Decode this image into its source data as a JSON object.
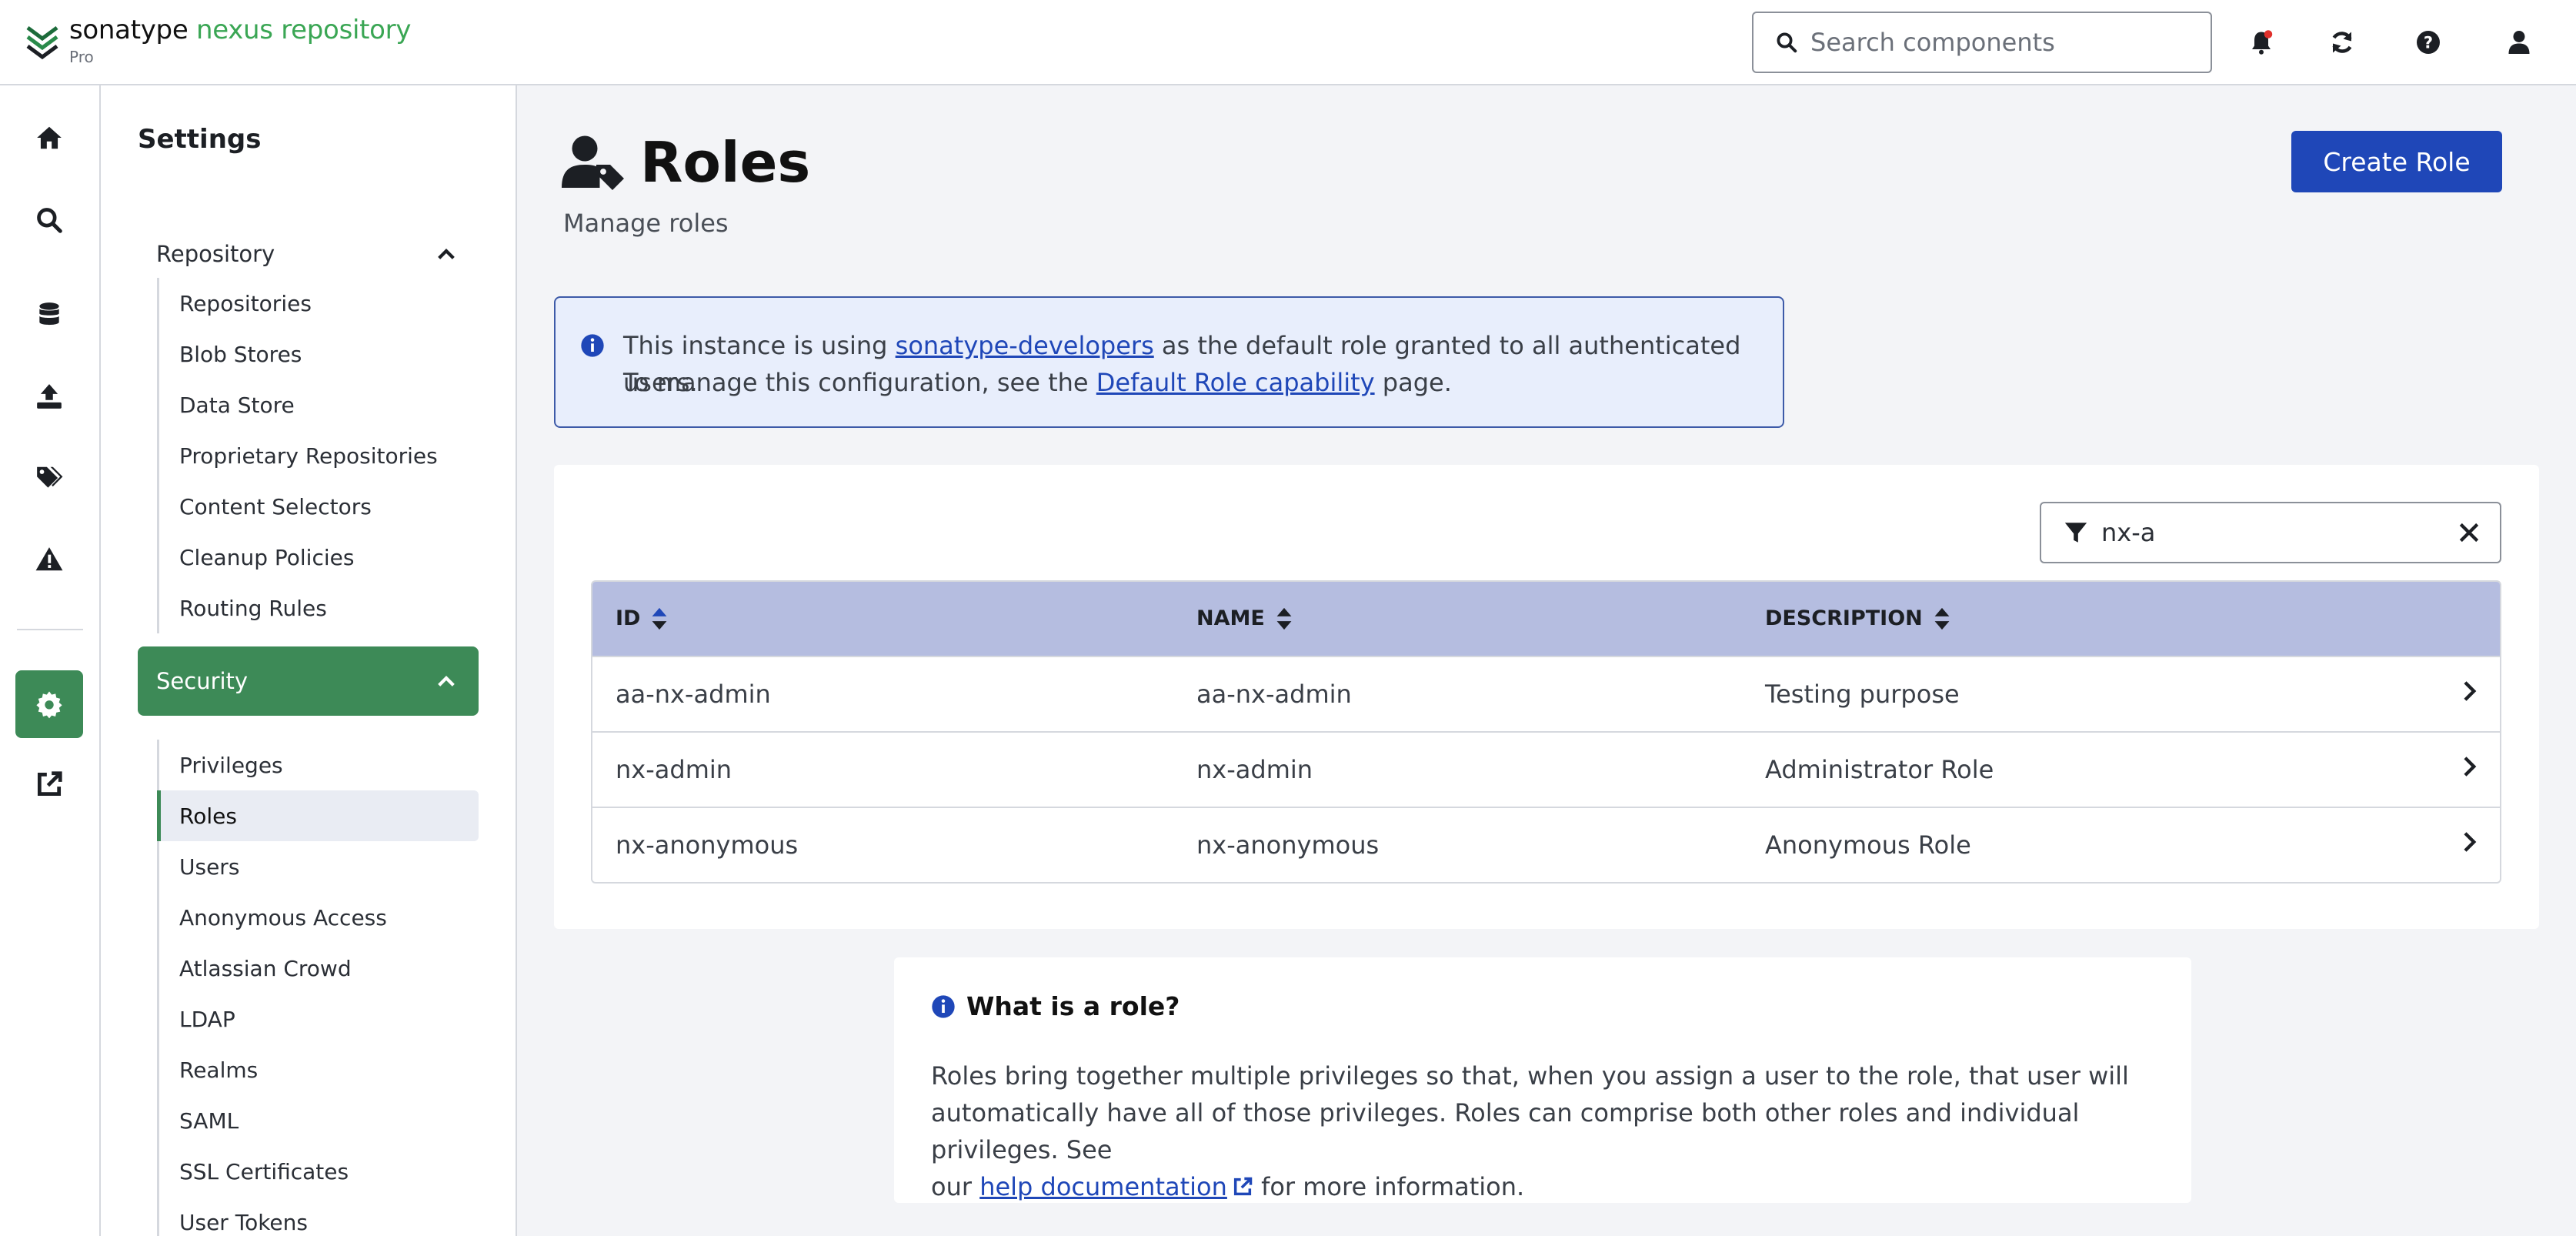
{
  "header": {
    "brand": "sonatype",
    "product": "nexus repository",
    "edition": "Pro",
    "search_placeholder": "Search components",
    "icons": [
      "bell-icon",
      "refresh-icon",
      "help-icon",
      "user-icon"
    ],
    "notification_dot_color": "#e0302b"
  },
  "rail": {
    "items": [
      "home-icon",
      "search-icon",
      "database-icon",
      "upload-icon",
      "tags-icon",
      "warning-icon",
      "gear-icon",
      "external-link-icon"
    ],
    "active": "gear-icon"
  },
  "sidebar": {
    "title": "Settings",
    "groups": [
      {
        "label": "Repository",
        "expanded": true,
        "items": [
          "Repositories",
          "Blob Stores",
          "Data Store",
          "Proprietary Repositories",
          "Content Selectors",
          "Cleanup Policies",
          "Routing Rules"
        ]
      },
      {
        "label": "Security",
        "expanded": true,
        "active": true,
        "items": [
          "Privileges",
          "Roles",
          "Users",
          "Anonymous Access",
          "Atlassian Crowd",
          "LDAP",
          "Realms",
          "SAML",
          "SSL Certificates",
          "User Tokens"
        ],
        "active_item": "Roles"
      }
    ]
  },
  "page": {
    "title": "Roles",
    "subtitle": "Manage roles",
    "create_button": "Create Role"
  },
  "alert": {
    "line1_prefix": "This instance is using ",
    "line1_link": "sonatype-developers",
    "line1_suffix": " as the default role granted to all authenticated users.",
    "line2_prefix": "To manage this configuration, see the ",
    "line2_link": "Default Role capability",
    "line2_suffix": " page."
  },
  "filter": {
    "value": "nx-a"
  },
  "table": {
    "columns": [
      "ID",
      "NAME",
      "DESCRIPTION"
    ],
    "rows": [
      {
        "id": "aa-nx-admin",
        "name": "aa-nx-admin",
        "description": "Testing purpose"
      },
      {
        "id": "nx-admin",
        "name": "nx-admin",
        "description": "Administrator Role"
      },
      {
        "id": "nx-anonymous",
        "name": "nx-anonymous",
        "description": "Anonymous Role"
      }
    ]
  },
  "info": {
    "title": "What is a role?",
    "body_line1": "Roles bring together multiple privileges so that, when you assign a user to the role, that user will",
    "body_line2": "automatically have all of those privileges. Roles can comprise both other roles and individual privileges. See",
    "body_line3_prefix": "our ",
    "body_link": "help documentation",
    "body_line3_suffix": " for more information."
  },
  "colors": {
    "accent_green": "#3d8a57",
    "primary_blue": "#1f47b8",
    "table_header": "#b5bde0",
    "brand_green": "#3aa654"
  }
}
